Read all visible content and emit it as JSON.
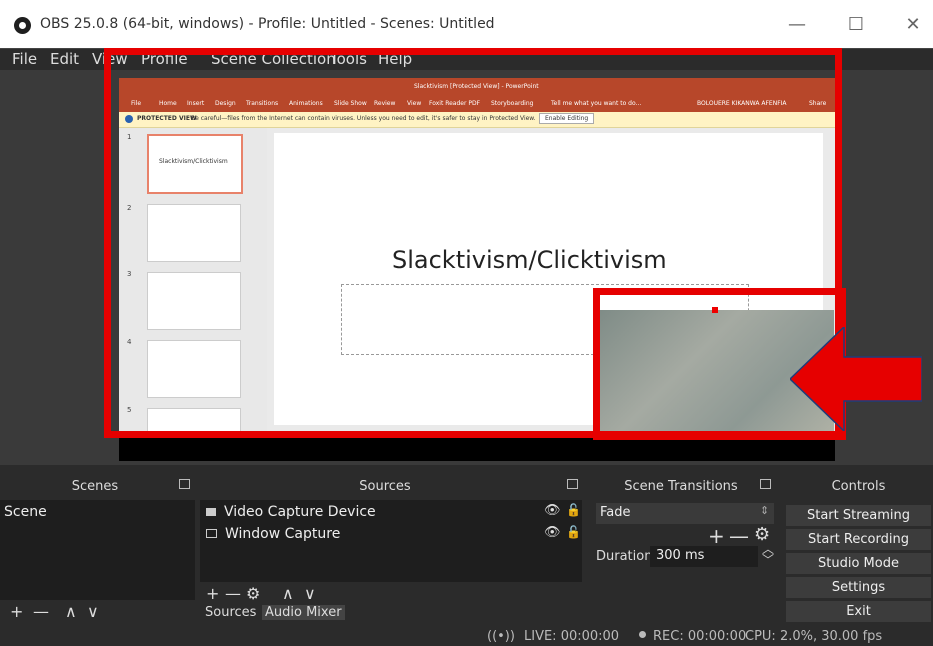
{
  "window": {
    "title": "OBS 25.0.8 (64-bit, windows) - Profile: Untitled - Scenes: Untitled",
    "minimize": "—",
    "maximize": "☐",
    "close": "✕"
  },
  "menu": {
    "file": "File",
    "edit": "Edit",
    "view": "View",
    "profile": "Profile",
    "scene_collection": "Scene Collection",
    "tools": "Tools",
    "help": "Help"
  },
  "preview": {
    "ppt_window_title": "Slacktivism [Protected View] - PowerPoint",
    "ribbon_tabs": [
      "File",
      "Home",
      "Insert",
      "Design",
      "Transitions",
      "Animations",
      "Slide Show",
      "Review",
      "View",
      "Foxit Reader PDF",
      "Storyboarding"
    ],
    "tell_me": "Tell me what you want to do...",
    "user": "BOLOUERE KIKANWA AFENFIA",
    "share": "Share",
    "protected_label": "PROTECTED VIEW",
    "protected_msg": "Be careful—files from the Internet can contain viruses. Unless you need to edit, it's safer to stay in Protected View.",
    "enable_editing": "Enable Editing",
    "thumbnails": [
      {
        "num": "1",
        "text": "Slacktivism/Clicktivism"
      },
      {
        "num": "2",
        "text": ""
      },
      {
        "num": "3",
        "text": ""
      },
      {
        "num": "4",
        "text": ""
      },
      {
        "num": "5",
        "text": ""
      }
    ],
    "slide_title": "Slacktivism/Clicktivism"
  },
  "docks": {
    "scenes": {
      "title": "Scenes",
      "items": [
        "Scene"
      ]
    },
    "sources": {
      "title": "Sources",
      "items": [
        {
          "label": "Video Capture Device"
        },
        {
          "label": "Window Capture"
        }
      ],
      "tabs": [
        "Sources",
        "Audio Mixer"
      ]
    },
    "transitions": {
      "title": "Scene Transitions",
      "selected": "Fade",
      "duration_label": "Duration",
      "duration_value": "300 ms"
    },
    "controls": {
      "title": "Controls",
      "buttons": [
        "Start Streaming",
        "Start Recording",
        "Studio Mode",
        "Settings",
        "Exit"
      ]
    }
  },
  "status": {
    "live": "LIVE: 00:00:00",
    "rec": "REC: 00:00:00",
    "cpu": "CPU: 2.0%, 30.00 fps"
  },
  "colors": {
    "highlight": "#e60000",
    "dock_bg": "#2b2b2b",
    "ppt_accent": "#b7472a"
  }
}
